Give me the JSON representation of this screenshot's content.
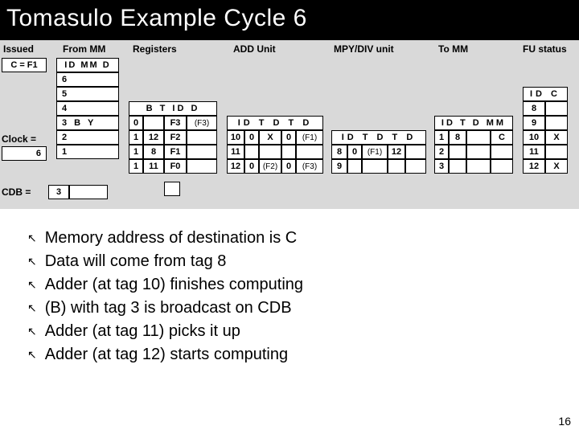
{
  "title": "Tomasulo Example Cycle 6",
  "page_number": "16",
  "headers": {
    "issued": "Issued",
    "from_mm": "From MM",
    "registers": "Registers",
    "add_unit": "ADD Unit",
    "mpy_div": "MPY/DIV unit",
    "to_mm": "To MM",
    "fu_status": "FU status"
  },
  "issued": {
    "val": "C = F1",
    "clock_label": "Clock =",
    "clock_val": "6",
    "cdb_label": "CDB =",
    "cdb_tag": "3"
  },
  "from_mm": {
    "top": "ID   MM   D",
    "rows": [
      "6",
      "5",
      "4",
      "3    B    Y",
      "2",
      "1"
    ]
  },
  "registers": {
    "hdr": "B    T    ID    D",
    "rows": [
      {
        "b": "0",
        "t": "",
        "id": "F3",
        "d": "(F3)"
      },
      {
        "b": "1",
        "t": "12",
        "id": "F2",
        "d": ""
      },
      {
        "b": "1",
        "t": "8",
        "id": "F1",
        "d": ""
      },
      {
        "b": "1",
        "t": "11",
        "id": "F0",
        "d": ""
      }
    ]
  },
  "add_unit": {
    "hdr": "ID    T    D    T    D",
    "rows": [
      {
        "id": "10",
        "t1": "0",
        "d1": "X",
        "t2": "0",
        "d2": "(F1)"
      },
      {
        "id": "11",
        "t1": "",
        "d1": "",
        "t2": "",
        "d2": ""
      },
      {
        "id": "12",
        "t1": "0",
        "d1": "(F2)",
        "t2": "0",
        "d2": "(F3)"
      }
    ]
  },
  "mpy_div": {
    "hdr": "ID    T    D    T    D",
    "rows": [
      {
        "id": "8",
        "t1": "0",
        "d1": "(F1)",
        "t2": "12",
        "d2": ""
      },
      {
        "id": "9",
        "t1": "",
        "d1": "",
        "t2": "",
        "d2": ""
      }
    ]
  },
  "to_mm": {
    "hdr": "ID    T    D   MM",
    "rows": [
      {
        "id": "1",
        "t": "8",
        "d": "",
        "mm": "C"
      },
      {
        "id": "2",
        "t": "",
        "d": "",
        "mm": ""
      },
      {
        "id": "3",
        "t": "",
        "d": "",
        "mm": ""
      }
    ]
  },
  "fu_status": {
    "hdr": "ID   C",
    "rows": [
      {
        "id": "8",
        "c": ""
      },
      {
        "id": "9",
        "c": ""
      },
      {
        "id": "10",
        "c": "X"
      },
      {
        "id": "11",
        "c": ""
      },
      {
        "id": "12",
        "c": "X"
      }
    ]
  },
  "notes": [
    "Memory address of destination is C",
    "Data will come from tag 8",
    "Adder (at tag 10) finishes computing",
    "(B) with tag 3 is broadcast on CDB",
    "Adder (at tag 11) picks it up",
    "Adder (at tag 12) starts computing"
  ],
  "chart_data": {
    "type": "table",
    "title": "Tomasulo Example Cycle 6",
    "clock": 6,
    "cdb_tag": 3,
    "issued": "C = F1",
    "from_mm_queue": [
      {
        "id": 6
      },
      {
        "id": 5
      },
      {
        "id": 4
      },
      {
        "id": 3,
        "mm": "B",
        "d": "Y"
      },
      {
        "id": 2
      },
      {
        "id": 1
      }
    ],
    "registers": [
      {
        "reg": "F3",
        "busy": 0,
        "tag": null,
        "data": "(F3)"
      },
      {
        "reg": "F2",
        "busy": 1,
        "tag": 12,
        "data": null
      },
      {
        "reg": "F1",
        "busy": 1,
        "tag": 8,
        "data": null
      },
      {
        "reg": "F0",
        "busy": 1,
        "tag": 11,
        "data": null
      }
    ],
    "add_unit": [
      {
        "id": 10,
        "src1_tag": 0,
        "src1_data": "X",
        "src2_tag": 0,
        "src2_data": "(F1)"
      },
      {
        "id": 11
      },
      {
        "id": 12,
        "src1_tag": 0,
        "src1_data": "(F2)",
        "src2_tag": 0,
        "src2_data": "(F3)"
      }
    ],
    "mpy_div_unit": [
      {
        "id": 8,
        "src1_tag": 0,
        "src1_data": "(F1)",
        "src2_tag": 12,
        "src2_data": null
      },
      {
        "id": 9
      }
    ],
    "to_mm": [
      {
        "id": 1,
        "tag": 8,
        "data": null,
        "mm": "C"
      },
      {
        "id": 2
      },
      {
        "id": 3
      }
    ],
    "fu_status": [
      {
        "id": 8,
        "computing": false
      },
      {
        "id": 9,
        "computing": false
      },
      {
        "id": 10,
        "computing": true
      },
      {
        "id": 11,
        "computing": false
      },
      {
        "id": 12,
        "computing": true
      }
    ]
  }
}
